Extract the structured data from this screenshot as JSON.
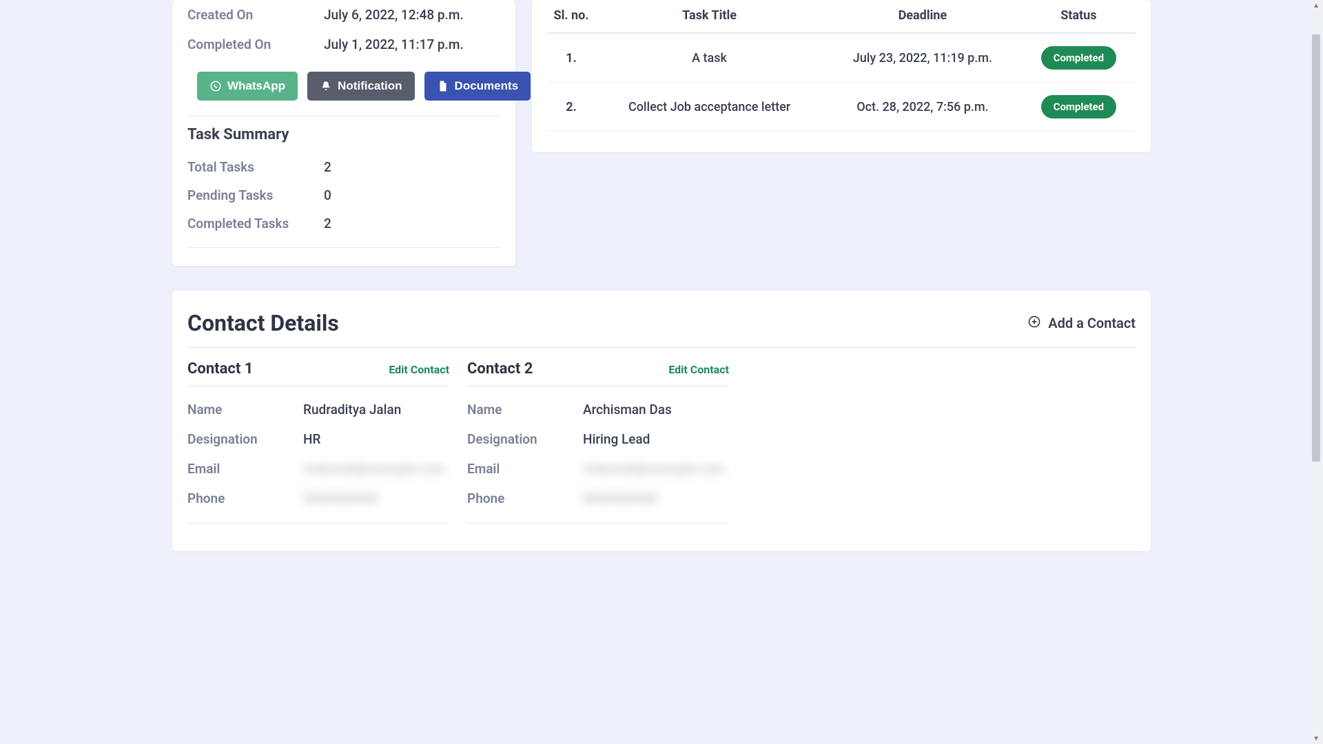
{
  "info": {
    "created_on_label": "Created On",
    "created_on_value": "July 6, 2022, 12:48 p.m.",
    "completed_on_label": "Completed On",
    "completed_on_value": "July 1, 2022, 11:17 p.m."
  },
  "buttons": {
    "whatsapp": "WhatsApp",
    "notification": "Notification",
    "documents": "Documents"
  },
  "task_summary": {
    "title": "Task Summary",
    "total_label": "Total Tasks",
    "total_value": "2",
    "pending_label": "Pending Tasks",
    "pending_value": "0",
    "completed_label": "Completed Tasks",
    "completed_value": "2"
  },
  "tasks_table": {
    "headers": {
      "sl": "Sl. no.",
      "title": "Task Title",
      "deadline": "Deadline",
      "status": "Status"
    },
    "rows": [
      {
        "sl": "1.",
        "title": "A task",
        "deadline": "July 23, 2022, 11:19 p.m.",
        "status": "Completed"
      },
      {
        "sl": "2.",
        "title": "Collect Job acceptance letter",
        "deadline": "Oct. 28, 2022, 7:56 p.m.",
        "status": "Completed"
      }
    ]
  },
  "contact_section": {
    "heading": "Contact Details",
    "add_label": "Add a Contact",
    "edit_label": "Edit Contact",
    "labels": {
      "name": "Name",
      "designation": "Designation",
      "email": "Email",
      "phone": "Phone"
    },
    "contacts": [
      {
        "header": "Contact 1",
        "name": "Rudraditya Jalan",
        "designation": "HR",
        "email": "redacted@example.com",
        "phone": "0000000000"
      },
      {
        "header": "Contact 2",
        "name": "Archisman Das",
        "designation": "Hiring Lead",
        "email": "redacted@example.com",
        "phone": "0000000000"
      }
    ]
  }
}
